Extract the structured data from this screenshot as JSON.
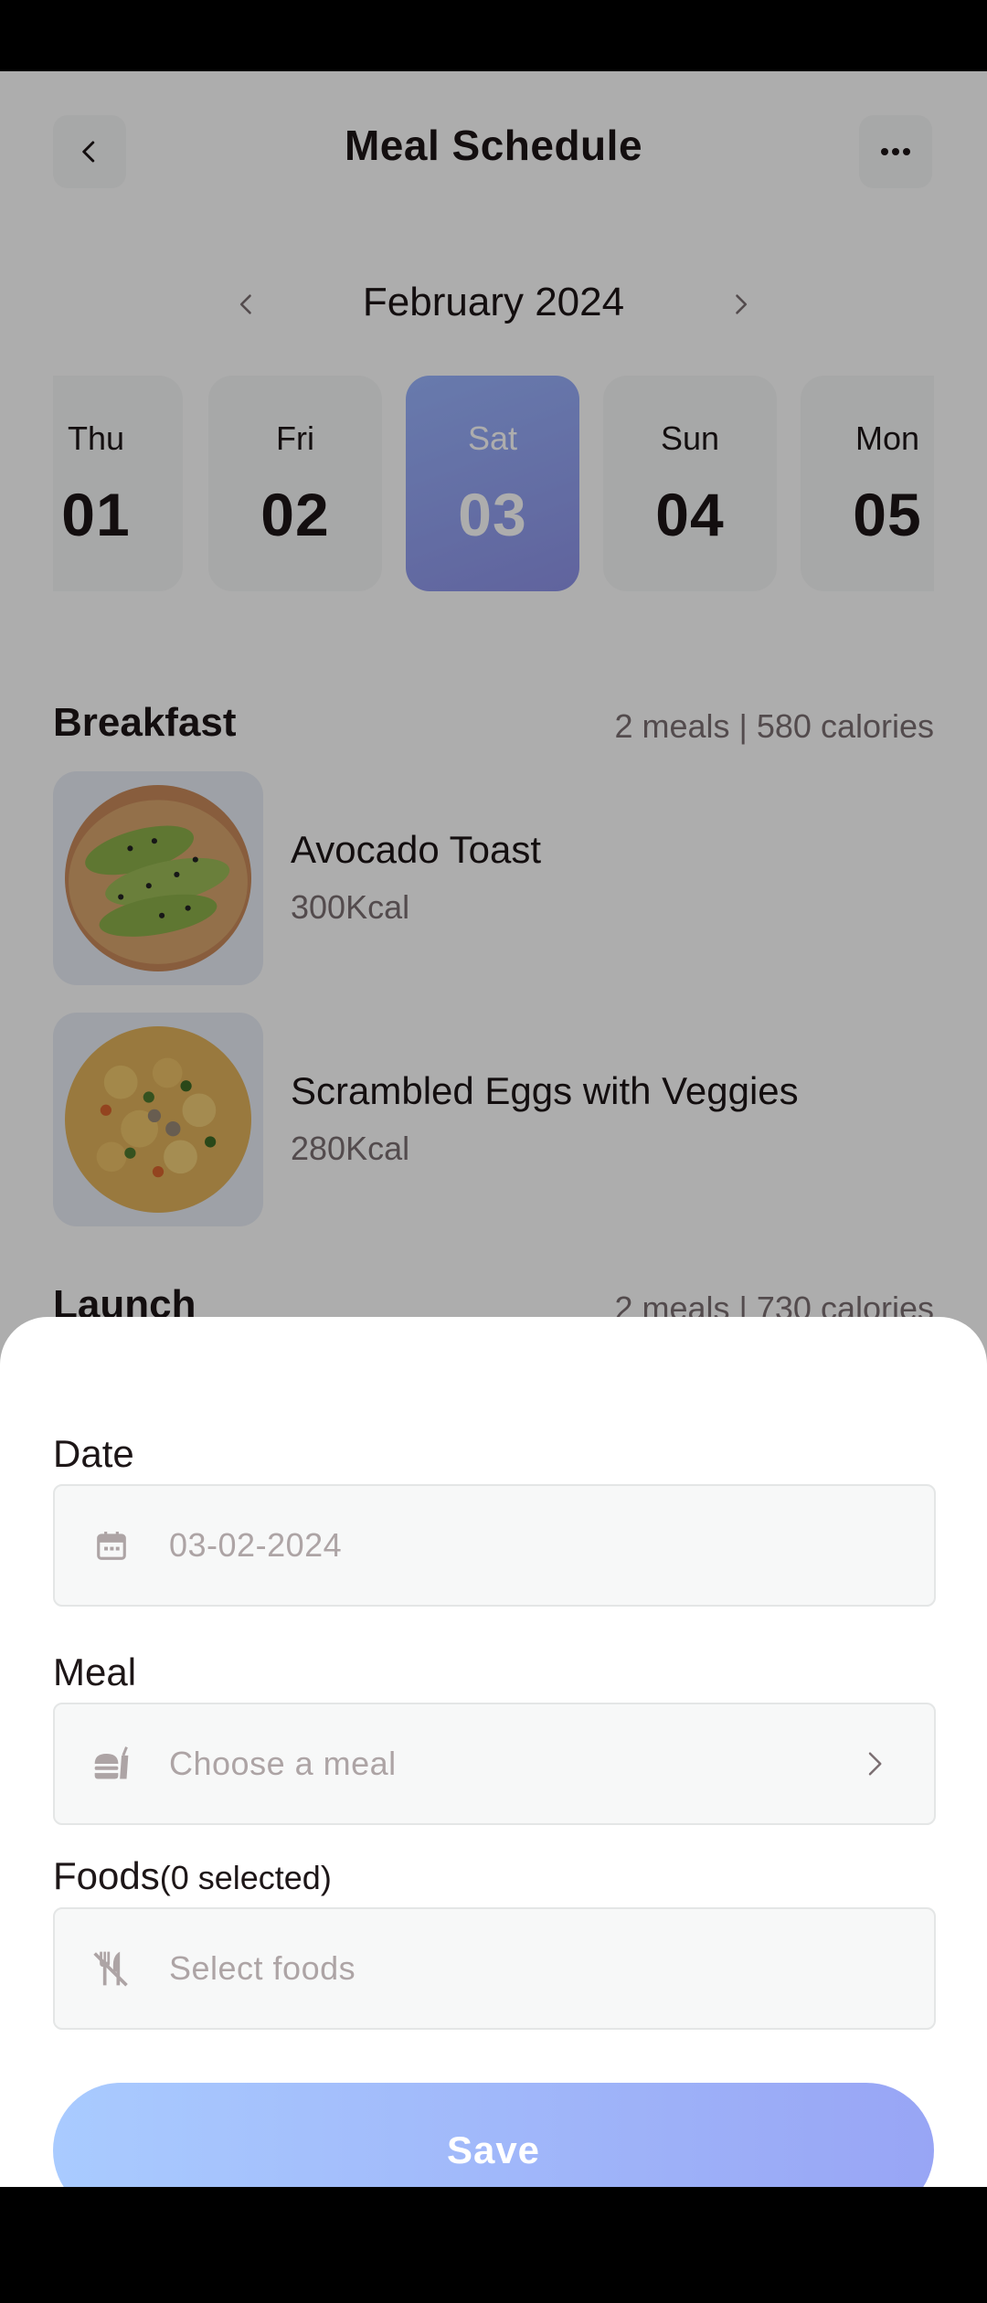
{
  "header": {
    "title": "Meal Schedule"
  },
  "month": {
    "label": "February 2024"
  },
  "days": [
    {
      "name": "Thu",
      "num": "01"
    },
    {
      "name": "Fri",
      "num": "02"
    },
    {
      "name": "Sat",
      "num": "03"
    },
    {
      "name": "Sun",
      "num": "04"
    },
    {
      "name": "Mon",
      "num": "05"
    }
  ],
  "selected_day": "Sat",
  "breakfast": {
    "title": "Breakfast",
    "info": "2 meals | 580 calories",
    "meals": [
      {
        "name": "Avocado Toast",
        "kcal": "300Kcal"
      },
      {
        "name": "Scrambled Eggs with Veggies",
        "kcal": "280Kcal"
      }
    ]
  },
  "lunch": {
    "title": "Launch",
    "info": "2 meals | 730 calories"
  },
  "sheet": {
    "date_label": "Date",
    "date_value": "03-02-2024",
    "meal_label": "Meal",
    "meal_placeholder": "Choose a meal",
    "foods_label": "Foods",
    "foods_count": "(0 selected)",
    "foods_placeholder": "Select foods",
    "save_label": "Save"
  },
  "colors": {
    "accent_start": "#A9CBFF",
    "accent_end": "#98A5F5",
    "text": "#1D1617",
    "muted": "#7B6F72"
  }
}
